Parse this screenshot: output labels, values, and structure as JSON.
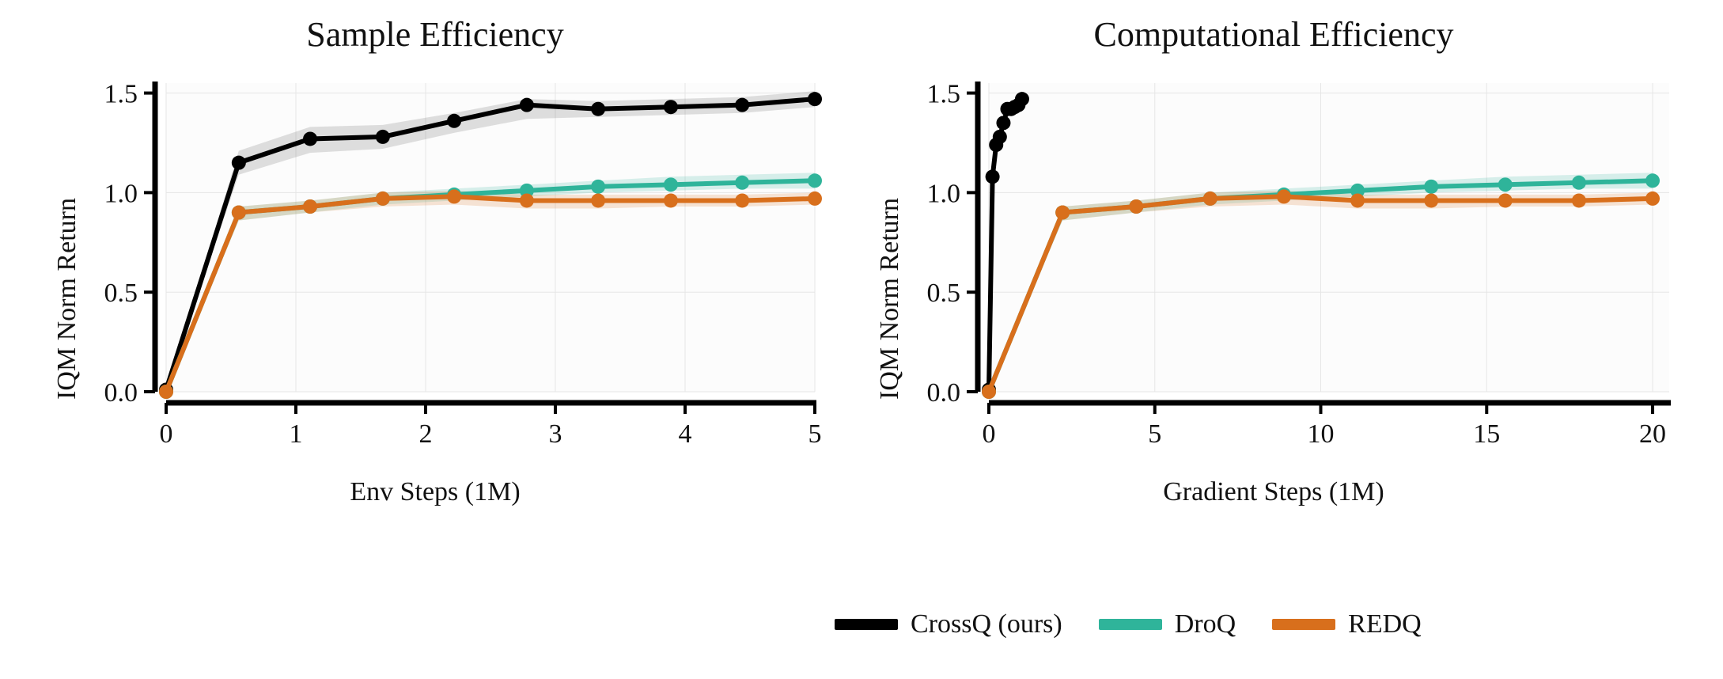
{
  "legend": {
    "items": [
      {
        "label": "CrossQ (ours)",
        "color": "#000000"
      },
      {
        "label": "DroQ",
        "color": "#2fb49a"
      },
      {
        "label": "REDQ",
        "color": "#d86f1c"
      }
    ]
  },
  "chart_data": [
    {
      "type": "line",
      "title": "Sample Efficiency",
      "xlabel": "Env Steps (1M)",
      "ylabel": "IQM Norm Return",
      "xlim": [
        0,
        5
      ],
      "ylim": [
        0.0,
        1.55
      ],
      "xticks": [
        0,
        1,
        2,
        3,
        4,
        5
      ],
      "yticks": [
        0.0,
        0.5,
        1.0,
        1.5
      ],
      "series": [
        {
          "name": "CrossQ (ours)",
          "color": "#000000",
          "band_color": "rgba(0,0,0,0.12)",
          "x": [
            0.0,
            0.56,
            1.11,
            1.67,
            2.22,
            2.78,
            3.33,
            3.89,
            4.44,
            5.0
          ],
          "values": [
            0.01,
            1.15,
            1.27,
            1.28,
            1.36,
            1.44,
            1.42,
            1.43,
            1.44,
            1.47
          ],
          "lo": [
            0.01,
            1.09,
            1.2,
            1.22,
            1.3,
            1.37,
            1.38,
            1.39,
            1.4,
            1.43
          ],
          "hi": [
            0.01,
            1.21,
            1.33,
            1.34,
            1.4,
            1.47,
            1.46,
            1.47,
            1.48,
            1.51
          ]
        },
        {
          "name": "DroQ",
          "color": "#2fb49a",
          "band_color": "rgba(47,180,154,0.18)",
          "x": [
            0.0,
            0.56,
            1.11,
            1.67,
            2.22,
            2.78,
            3.33,
            3.89,
            4.44,
            5.0
          ],
          "values": [
            0.0,
            0.9,
            0.93,
            0.97,
            0.99,
            1.01,
            1.03,
            1.04,
            1.05,
            1.06
          ],
          "lo": [
            0.0,
            0.86,
            0.9,
            0.94,
            0.96,
            0.98,
            1.0,
            1.01,
            1.02,
            1.02
          ],
          "hi": [
            0.0,
            0.93,
            0.96,
            1.0,
            1.02,
            1.04,
            1.06,
            1.08,
            1.09,
            1.1
          ]
        },
        {
          "name": "REDQ",
          "color": "#d86f1c",
          "band_color": "rgba(216,111,28,0.18)",
          "x": [
            0.0,
            0.56,
            1.11,
            1.67,
            2.22,
            2.78,
            3.33,
            3.89,
            4.44,
            5.0
          ],
          "values": [
            0.0,
            0.9,
            0.93,
            0.97,
            0.98,
            0.96,
            0.96,
            0.96,
            0.96,
            0.97
          ],
          "lo": [
            0.0,
            0.86,
            0.9,
            0.93,
            0.94,
            0.92,
            0.92,
            0.93,
            0.93,
            0.94
          ],
          "hi": [
            0.0,
            0.93,
            0.96,
            1.0,
            1.01,
            0.99,
            0.99,
            0.99,
            0.99,
            1.0
          ]
        }
      ]
    },
    {
      "type": "line",
      "title": "Computational Efficiency",
      "xlabel": "Gradient Steps (1M)",
      "ylabel": "IQM Norm Return",
      "xlim": [
        0,
        20.5
      ],
      "ylim": [
        0.0,
        1.55
      ],
      "xticks": [
        0,
        5,
        10,
        15,
        20
      ],
      "yticks": [
        0.0,
        0.5,
        1.0,
        1.5
      ],
      "series": [
        {
          "name": "CrossQ (ours)",
          "color": "#000000",
          "band_color": "rgba(0,0,0,0.12)",
          "x": [
            0.0,
            0.11,
            0.22,
            0.33,
            0.44,
            0.56,
            0.67,
            0.78,
            0.89,
            1.0
          ],
          "values": [
            0.01,
            1.08,
            1.24,
            1.28,
            1.35,
            1.42,
            1.42,
            1.43,
            1.44,
            1.47
          ],
          "lo": [
            0.01,
            1.04,
            1.2,
            1.24,
            1.31,
            1.38,
            1.39,
            1.4,
            1.41,
            1.44
          ],
          "hi": [
            0.01,
            1.12,
            1.28,
            1.32,
            1.39,
            1.45,
            1.46,
            1.47,
            1.49,
            1.51
          ]
        },
        {
          "name": "DroQ",
          "color": "#2fb49a",
          "band_color": "rgba(47,180,154,0.18)",
          "x": [
            0.0,
            2.22,
            4.44,
            6.67,
            8.89,
            11.11,
            13.33,
            15.56,
            17.78,
            20.0
          ],
          "values": [
            0.0,
            0.9,
            0.93,
            0.97,
            0.99,
            1.01,
            1.03,
            1.04,
            1.05,
            1.06
          ],
          "lo": [
            0.0,
            0.86,
            0.9,
            0.94,
            0.96,
            0.98,
            1.0,
            1.01,
            1.02,
            1.02
          ],
          "hi": [
            0.0,
            0.93,
            0.96,
            1.0,
            1.02,
            1.04,
            1.06,
            1.08,
            1.09,
            1.1
          ]
        },
        {
          "name": "REDQ",
          "color": "#d86f1c",
          "band_color": "rgba(216,111,28,0.18)",
          "x": [
            0.0,
            2.22,
            4.44,
            6.67,
            8.89,
            11.11,
            13.33,
            15.56,
            17.78,
            20.0
          ],
          "values": [
            0.0,
            0.9,
            0.93,
            0.97,
            0.98,
            0.96,
            0.96,
            0.96,
            0.96,
            0.97
          ],
          "lo": [
            0.0,
            0.86,
            0.9,
            0.93,
            0.94,
            0.92,
            0.92,
            0.93,
            0.93,
            0.94
          ],
          "hi": [
            0.0,
            0.93,
            0.96,
            1.0,
            1.01,
            0.99,
            0.99,
            0.99,
            0.99,
            1.0
          ]
        }
      ]
    }
  ]
}
